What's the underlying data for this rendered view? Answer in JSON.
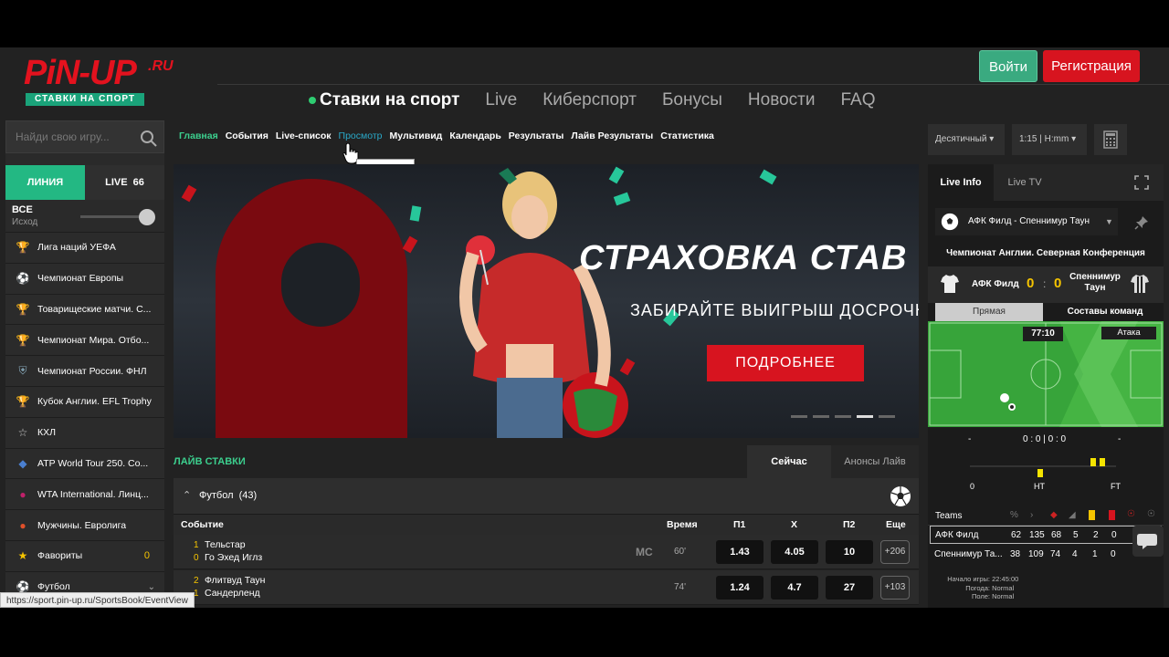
{
  "header": {
    "logo_text": "PiN-UP",
    "logo_ru": ".RU",
    "logo_sub": "СТАВКИ НА СПОРТ",
    "login_label": "Войти",
    "register_label": "Регистрация",
    "nav": [
      "Ставки на спорт",
      "Live",
      "Киберспорт",
      "Бонусы",
      "Новости",
      "FAQ"
    ]
  },
  "sidebar": {
    "search_placeholder": "Найди свою игру...",
    "tab_line": "ЛИНИЯ",
    "tab_live": "LIVE",
    "tab_live_count": "66",
    "all_label": "ВСЕ",
    "outcome_label": "Исход",
    "items": [
      {
        "label": "Лига наций УЕФА",
        "icon": "trophy-icon"
      },
      {
        "label": "Чемпионат Европы",
        "icon": "ball-icon"
      },
      {
        "label": "Товарищеские матчи. С...",
        "icon": "trophy-icon"
      },
      {
        "label": "Чемпионат Мира. Отбо...",
        "icon": "trophy-icon"
      },
      {
        "label": "Чемпионат России. ФНЛ",
        "icon": "badge-icon"
      },
      {
        "label": "Кубок Англии. EFL Trophy",
        "icon": "trophy-icon"
      },
      {
        "label": "КХЛ",
        "icon": "khl-icon"
      },
      {
        "label": "ATP World Tour 250. Co...",
        "icon": "atp-icon"
      },
      {
        "label": "WTA International. Линц...",
        "icon": "wta-icon"
      },
      {
        "label": "Мужчины. Евролига",
        "icon": "basketball-icon"
      },
      {
        "label": "Фавориты",
        "icon": "star-icon",
        "count": "0"
      },
      {
        "label": "Футбол",
        "icon": "ball-icon"
      }
    ]
  },
  "subnav": [
    "Главная",
    "События",
    "Live-список",
    "Просмотр",
    "Мультивид",
    "Календарь",
    "Результаты",
    "Лайв Результаты",
    "Статистика"
  ],
  "tooltip": "Просмотр",
  "banner": {
    "title": "СТРАХОВКА СТАВ",
    "subtitle": "ЗАБИРАЙТЕ ВЫИГРЫШ ДОСРОЧН",
    "button": "ПОДРОБНЕЕ"
  },
  "live": {
    "title": "ЛАЙВ СТАВКИ",
    "tab_now": "Сейчас",
    "tab_announce": "Анонсы Лайв",
    "sport": "Футбол",
    "sport_count": "(43)",
    "columns": {
      "event": "Событие",
      "time": "Время",
      "p1": "П1",
      "x": "X",
      "p2": "П2",
      "more": "Еще"
    },
    "events": [
      {
        "n1": "1",
        "team1": "Тельстар",
        "n2": "0",
        "team2": "Го Эхед Иглз",
        "mc": "MC",
        "minute": "60'",
        "p1": "1.43",
        "x": "4.05",
        "p2": "10",
        "more": "+206"
      },
      {
        "n1": "2",
        "team1": "Флитвуд Таун",
        "n2": "1",
        "team2": "Сандерленд",
        "mc": "",
        "minute": "74'",
        "p1": "1.24",
        "x": "4.7",
        "p2": "27",
        "more": "+103"
      }
    ]
  },
  "status_url": "https://sport.pin-up.ru/SportsBook/EventView",
  "right": {
    "format": "Десятичный",
    "time": "1:15 | H:mm",
    "tab_info": "Live Info",
    "tab_tv": "Live TV",
    "match": "АФК Филд - Спеннимур Таун",
    "league": "Чемпионат Англии. Северная Конференция",
    "home": "АФК Филд",
    "away": "Спеннимур Таун",
    "score_home": "0",
    "score_away": "0",
    "score_sep": ":",
    "tab_direct": "Прямая",
    "tab_lineups": "Составы команд",
    "clock": "77:10",
    "attack": "Атака",
    "stat_left": "-",
    "stat_mid": "0 : 0 | 0 : 0",
    "stat_right": "-",
    "tl_start": "0",
    "tl_ht": "HT",
    "tl_ft": "FT",
    "teams_label": "Teams",
    "team_rows": [
      {
        "name": "АФК Филд",
        "a": "62",
        "b": "135",
        "c": "68",
        "d": "5",
        "e": "2",
        "f": "0"
      },
      {
        "name": "Спеннимур Та...",
        "a": "38",
        "b": "109",
        "c": "74",
        "d": "4",
        "e": "1",
        "f": "0"
      }
    ],
    "info": [
      {
        "label": "Начало игры:",
        "value": "22:45:00"
      },
      {
        "label": "Погода:",
        "value": "Normal"
      },
      {
        "label": "Поле:",
        "value": "Normal"
      }
    ],
    "colors": {
      "accent_green": "#23b883",
      "accent_red": "#d7141f",
      "score_yellow": "#f5c400"
    }
  }
}
